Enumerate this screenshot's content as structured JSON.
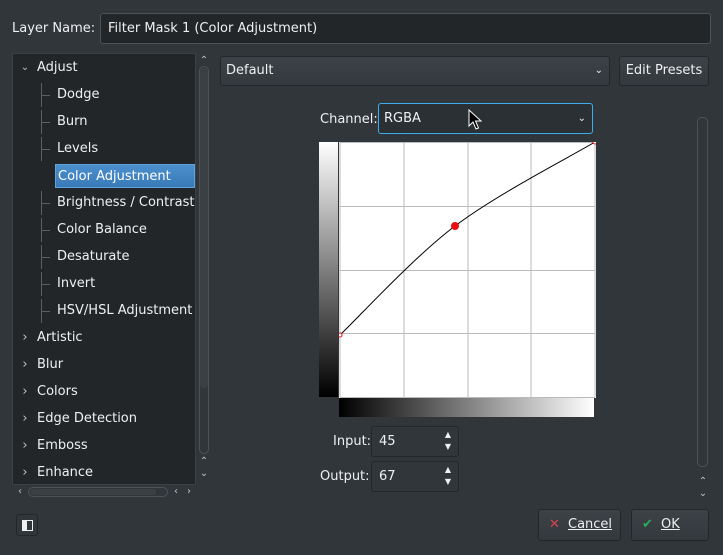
{
  "layer_name": {
    "label": "Layer Name:",
    "value": "Filter Mask 1 (Color Adjustment)"
  },
  "tree": {
    "items": [
      {
        "label": "Adjust",
        "expanded": true,
        "level": 0
      },
      {
        "label": "Dodge",
        "level": 1
      },
      {
        "label": "Burn",
        "level": 1
      },
      {
        "label": "Levels",
        "level": 1
      },
      {
        "label": "Color Adjustment",
        "level": 1,
        "selected": true
      },
      {
        "label": "Brightness / Contrast",
        "level": 1
      },
      {
        "label": "Color Balance",
        "level": 1
      },
      {
        "label": "Desaturate",
        "level": 1
      },
      {
        "label": "Invert",
        "level": 1
      },
      {
        "label": "HSV/HSL Adjustment",
        "level": 1
      },
      {
        "label": "Artistic",
        "expanded": false,
        "level": 0
      },
      {
        "label": "Blur",
        "expanded": false,
        "level": 0
      },
      {
        "label": "Colors",
        "expanded": false,
        "level": 0
      },
      {
        "label": "Edge Detection",
        "expanded": false,
        "level": 0
      },
      {
        "label": "Emboss",
        "expanded": false,
        "level": 0
      },
      {
        "label": "Enhance",
        "expanded": false,
        "level": 0
      }
    ]
  },
  "presets": {
    "selected": "Default",
    "edit_label": "Edit Presets"
  },
  "channel": {
    "label": "Channel:",
    "selected": "RGBA"
  },
  "curve": {
    "control_points": [
      {
        "input": 0,
        "output": 62
      },
      {
        "input": 115,
        "output": 171
      },
      {
        "input": 255,
        "output": 255
      }
    ],
    "selected_point_index": 1
  },
  "input": {
    "label": "Input:",
    "value": "45"
  },
  "output": {
    "label": "Output:",
    "value": "67"
  },
  "buttons": {
    "cancel": "Cancel",
    "ok": "OK"
  },
  "colors": {
    "accent": "#3daee9",
    "selection": "#3a7ab8",
    "curve_point": "#e81010"
  },
  "icons": {
    "cancel": "x-icon",
    "ok": "checkmark-icon",
    "sidebar_toggle": "sidebar-panel-icon"
  }
}
